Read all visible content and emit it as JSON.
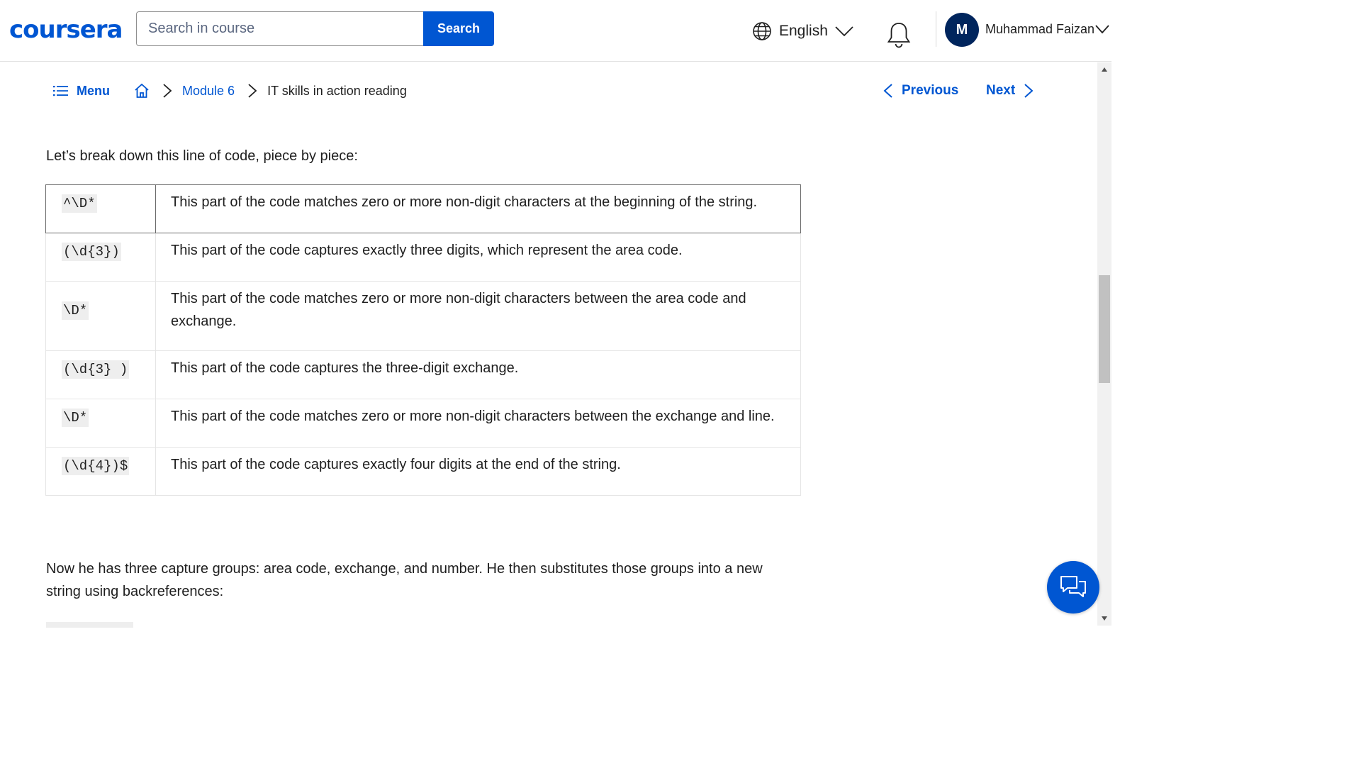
{
  "header": {
    "logo": "coursera",
    "search": {
      "placeholder": "Search in course",
      "button_label": "Search"
    },
    "language": "English",
    "user": {
      "initial": "M",
      "name": "Muhammad Faizan"
    }
  },
  "breadcrumb": {
    "menu_label": "Menu",
    "module": "Module 6",
    "current": "IT skills in action reading"
  },
  "pager": {
    "previous": "Previous",
    "next": "Next"
  },
  "content": {
    "intro": "Let’s break down this line of code, piece by piece:",
    "rows": [
      {
        "code": "^\\D*",
        "desc": "This part of the code matches zero or more non-digit characters at the beginning of the string."
      },
      {
        "code": "(\\d{3})",
        "desc": "This part of the code captures exactly three digits, which represent the area code."
      },
      {
        "code": "\\D*",
        "desc": "This part of the code matches zero or more non-digit characters between the area code and exchange."
      },
      {
        "code": "(\\d{3} )",
        "desc": "This part of the code captures the three-digit exchange."
      },
      {
        "code": "\\D*",
        "desc": "This part of the code matches zero or more non-digit characters between the exchange and line."
      },
      {
        "code": "(\\d{4})$",
        "desc": "This part of the code captures exactly four digits at the end of the string."
      }
    ],
    "paragraph": "Now he has three capture groups: area code, exchange, and number. He then substitutes those groups into a new string using backreferences:"
  },
  "icons": {
    "globe": "globe-icon",
    "bell": "bell-icon",
    "menu": "list-icon",
    "home": "home-icon",
    "chat": "chat-icon"
  },
  "colors": {
    "brand": "#0056d2",
    "avatar": "#00255d",
    "text": "#1f1f1f"
  }
}
